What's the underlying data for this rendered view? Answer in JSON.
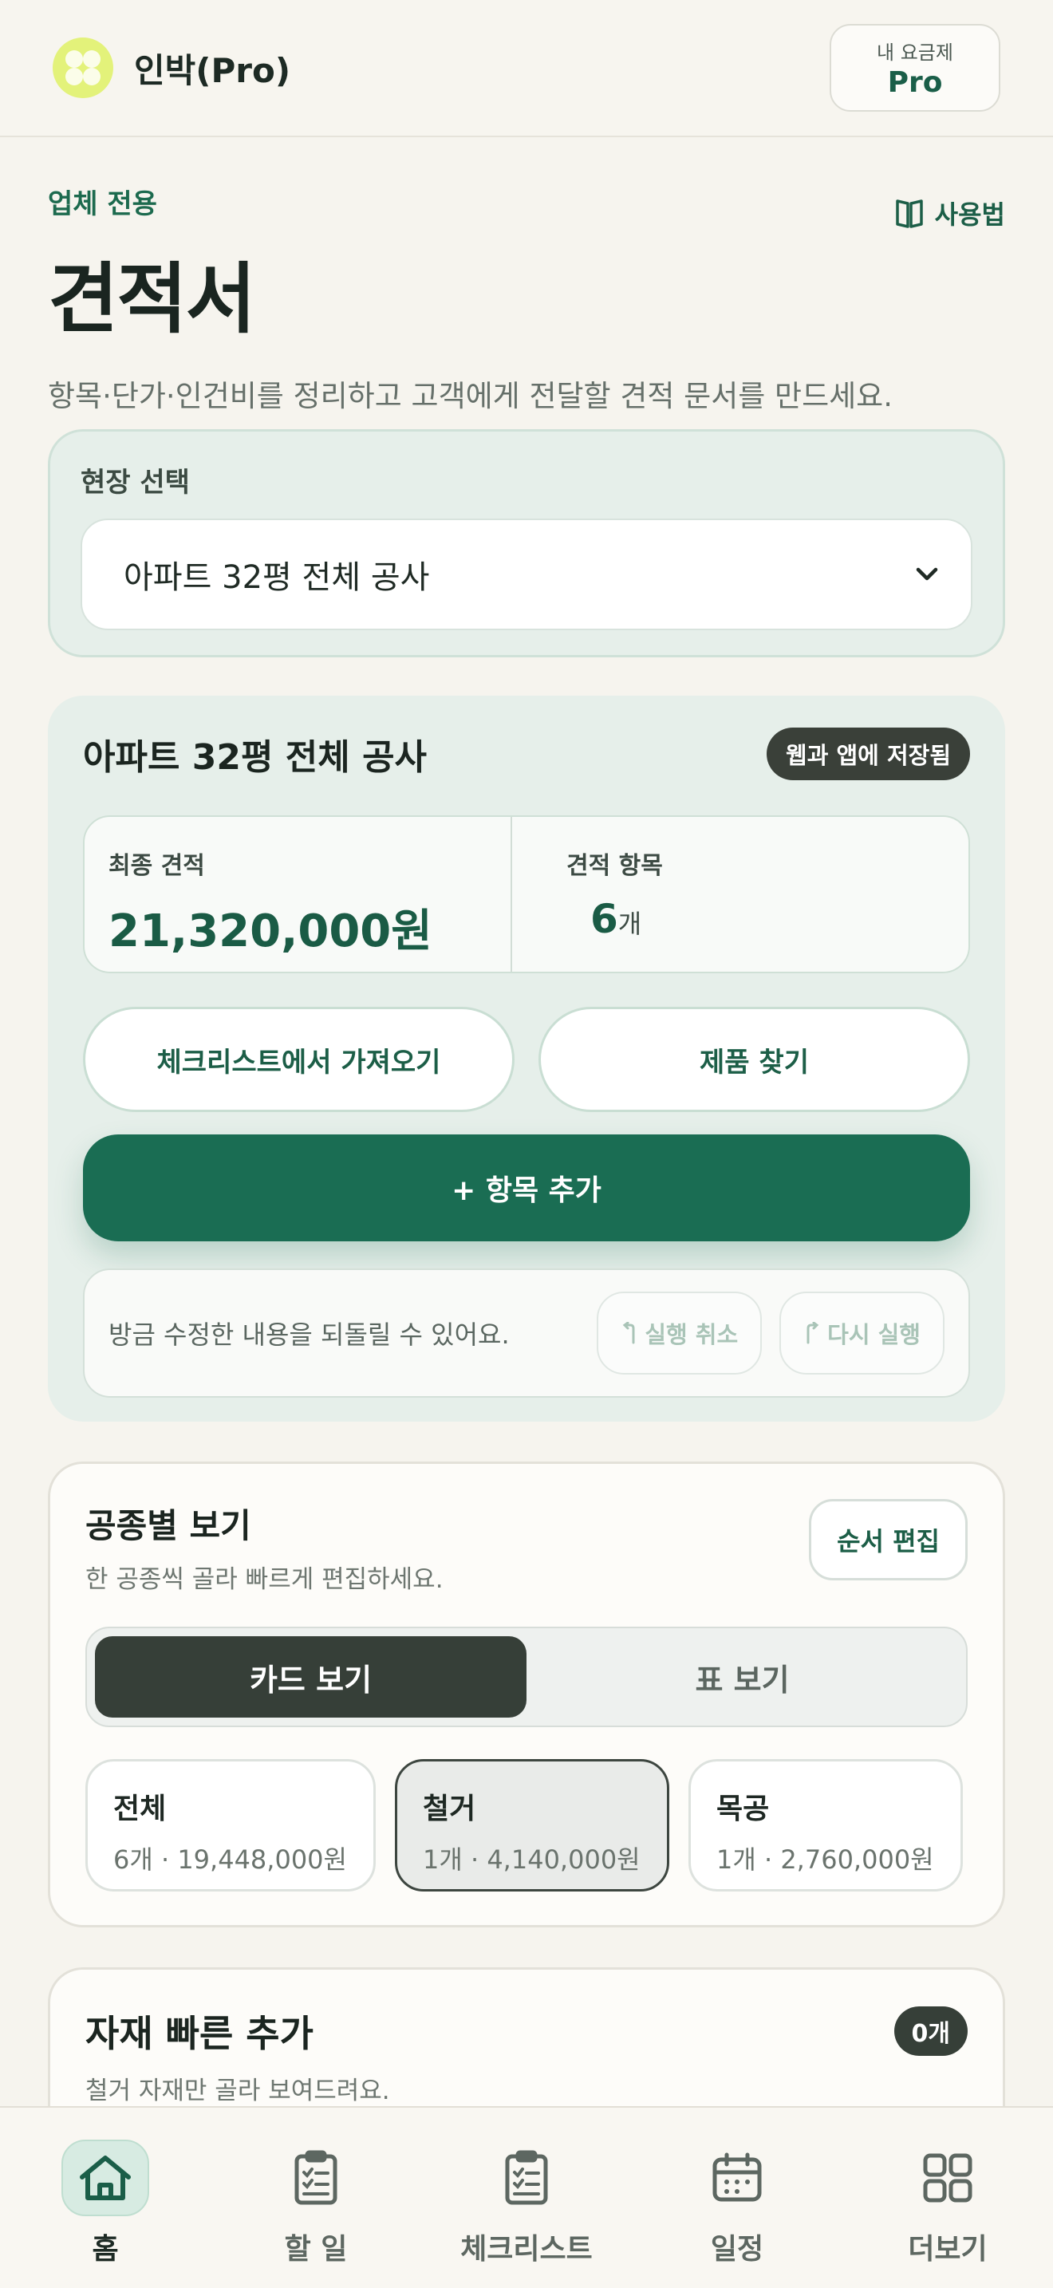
{
  "header": {
    "brand": "인박(Pro)",
    "plan_small": "내 요금제",
    "plan_big": "Pro"
  },
  "intro": {
    "eyebrow": "업체 전용",
    "title": "견적서",
    "description": "항목·단가·인건비를 정리하고 고객에게 전달할 견적 문서를 만드세요.",
    "howto": "사용법"
  },
  "site": {
    "label": "현장 선택",
    "selected": "아파트 32평 전체 공사"
  },
  "summary": {
    "title": "아파트 32평 전체 공사",
    "saved_badge": "웹과 앱에 저장됨",
    "final_label": "최종 견적",
    "final_value": "21,320,000원",
    "items_label": "견적 항목",
    "items_value": "6",
    "items_unit": "개",
    "import_button": "체크리스트에서 가져오기",
    "find_button": "제품 찾기",
    "add_button": "+ 항목 추가",
    "undo_text": "방금 수정한 내용을 되돌릴 수 있어요.",
    "undo_button": "실행 취소",
    "redo_button": "다시 실행"
  },
  "trade": {
    "title": "공종별 보기",
    "subtitle": "한 공종씩 골라 빠르게 편집하세요.",
    "order_button": "순서 편집",
    "tabs": [
      "카드 보기",
      "표 보기"
    ],
    "chips": [
      {
        "name": "전체",
        "meta": "6개 · 19,448,000원"
      },
      {
        "name": "철거",
        "meta": "1개 · 4,140,000원"
      },
      {
        "name": "목공",
        "meta": "1개 · 2,760,000원"
      }
    ]
  },
  "quick_add": {
    "title": "자재 빠른 추가",
    "count": "0개",
    "subtitle": "철거 자재만 골라 보여드려요."
  },
  "nav": [
    "홈",
    "할 일",
    "체크리스트",
    "일정",
    "더보기"
  ],
  "colors": {
    "brand_green": "#1a6d53",
    "dark": "#363f38",
    "logo": "#e3f27a"
  }
}
